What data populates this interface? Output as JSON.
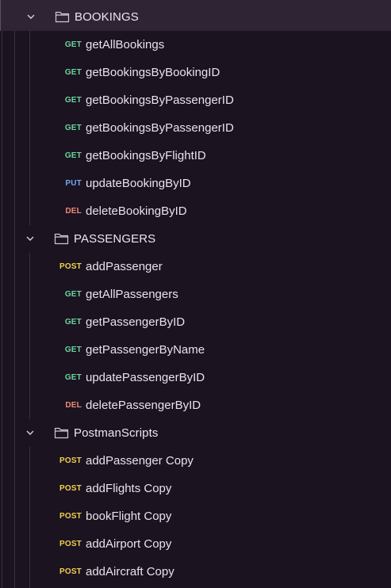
{
  "colors": {
    "background": "#1b1320",
    "selected_row": "#2e2434",
    "get": "#6bd59e",
    "put": "#74a8f0",
    "del": "#f08a76",
    "post": "#f0d04f",
    "text": "#e8e3ea"
  },
  "folders": [
    {
      "label": "BOOKINGS",
      "expanded": true,
      "chevron_icon": "chevron-down-icon",
      "folder_icon": "folder-icon",
      "requests": [
        {
          "method": "GET",
          "name": "getAllBookings"
        },
        {
          "method": "GET",
          "name": "getBookingsByBookingID"
        },
        {
          "method": "GET",
          "name": "getBookingsByPassengerID"
        },
        {
          "method": "GET",
          "name": "getBookingsByPassengerID"
        },
        {
          "method": "GET",
          "name": "getBookingsByFlightID"
        },
        {
          "method": "PUT",
          "name": "updateBookingByID"
        },
        {
          "method": "DEL",
          "name": "deleteBookingByID"
        }
      ]
    },
    {
      "label": "PASSENGERS",
      "expanded": true,
      "chevron_icon": "chevron-down-icon",
      "folder_icon": "folder-icon",
      "requests": [
        {
          "method": "POST",
          "name": "addPassenger"
        },
        {
          "method": "GET",
          "name": "getAllPassengers"
        },
        {
          "method": "GET",
          "name": "getPassengerByID"
        },
        {
          "method": "GET",
          "name": "getPassengerByName"
        },
        {
          "method": "GET",
          "name": "updatePassengerByID"
        },
        {
          "method": "DEL",
          "name": "deletePassengerByID"
        }
      ]
    },
    {
      "label": "PostmanScripts",
      "expanded": true,
      "chevron_icon": "chevron-down-icon",
      "folder_icon": "folder-icon",
      "requests": [
        {
          "method": "POST",
          "name": "addPassenger Copy"
        },
        {
          "method": "POST",
          "name": "addFlights Copy"
        },
        {
          "method": "POST",
          "name": "bookFlight Copy"
        },
        {
          "method": "POST",
          "name": "addAirport Copy"
        },
        {
          "method": "POST",
          "name": "addAircraft Copy"
        }
      ]
    }
  ]
}
